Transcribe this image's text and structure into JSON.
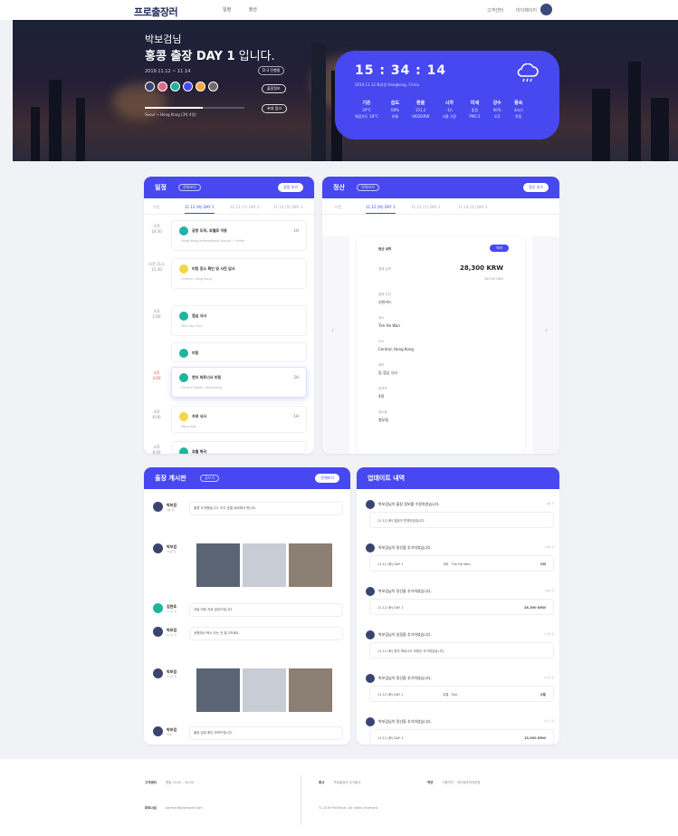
{
  "header": {
    "logo": "프로출장러",
    "nav": [
      "일정",
      "정산"
    ],
    "user_links": [
      "고객센터",
      "마이페이지"
    ]
  },
  "hero": {
    "greeting": "박보검님",
    "title_bold": "홍콩 출장 DAY 1",
    "title_light": " 입니다.",
    "date_range": "2019.11.12 ~ 11.14",
    "tag": "D-3 진행중",
    "edit_button": "출장정보",
    "share_button": "초대 링크",
    "progress": 0.58,
    "route": "Seoul → Hong Kong (3박 4일)",
    "member_colors": [
      "#3b4470",
      "#e06a8a",
      "#1fb4a0",
      "#4748f0",
      "#f3a93a",
      "#6b6b6b"
    ]
  },
  "clock": {
    "time": "15 : 34 : 14",
    "location": "2019.11.12 화요일   Hongkong, China",
    "weather_icon": "rain-cloud-icon",
    "columns": [
      {
        "label": "기온",
        "value": "19°C",
        "sub": "체감온도 18°C"
      },
      {
        "label": "습도",
        "value": "68%",
        "sub": "보통"
      },
      {
        "label": "환율",
        "value": "151.2",
        "sub": "HKD/KRW"
      },
      {
        "label": "시차",
        "value": "-1h",
        "sub": "서울 기준"
      },
      {
        "label": "미세",
        "value": "좋음",
        "sub": "PM2.5"
      },
      {
        "label": "강수",
        "value": "60%",
        "sub": "오후"
      },
      {
        "label": "풍속",
        "value": "3m/s",
        "sub": "북동"
      }
    ]
  },
  "schedule": {
    "title": "일정",
    "badge": "전체보기",
    "pill": "일정 추가",
    "tabs": [
      "이전",
      "11.12 (화) DAY 1",
      "11.13 (수) DAY 2",
      "11.14 (목) DAY 3"
    ],
    "items": [
      {
        "time_a": "오전",
        "time_b": "10:30",
        "name": "공항 도착, 호텔로 이동",
        "right": "1H",
        "sub": "Hong Kong International Airport → Hotel",
        "color": "#1fb4a0"
      },
      {
        "time_a": "오전 11시",
        "time_b": "11:30",
        "name": "미팅 장소 확인 및 사전 답사",
        "right": "",
        "sub": "Central, Hong Kong",
        "color": "#f5d547"
      },
      {
        "time_a": "오후",
        "time_b": "1:00",
        "name": "점심 식사",
        "right": "",
        "sub": "Tsim Sha Tsui",
        "color": "#1fb4a0"
      },
      {
        "time_a": "",
        "time_b": "",
        "name": "미팅",
        "right": "",
        "sub": "",
        "color": "#1fb4a0"
      },
      {
        "time_a": "오후",
        "time_b": "3:00",
        "name": "현지 파트너사 미팅",
        "right": "2H",
        "sub": "Central Tower, Hong Kong",
        "color": "#1fb4a0"
      },
      {
        "time_a": "오후",
        "time_b": "6:00",
        "name": "저녁 식사",
        "right": "1H",
        "sub": "Mong Kok",
        "color": "#f5d547"
      },
      {
        "time_a": "오후",
        "time_b": "8:00",
        "name": "호텔 복귀",
        "right": "",
        "sub": "",
        "color": "#1fb4a0"
      }
    ]
  },
  "expense": {
    "title": "정산",
    "badge": "전체보기",
    "pill": "정산 추가",
    "tabs": [
      "이전",
      "11.12 (화) DAY 1",
      "11.13 (수) DAY 2",
      "11.14 (목) DAY 3"
    ],
    "card_title": "정산 내역",
    "category": "식비",
    "amount_label": "결제 금액",
    "amount": "28,300 KRW",
    "converted": "185.00 HKD",
    "fields": [
      {
        "label": "결제 수단",
        "value": "신한카드"
      },
      {
        "label": "장소",
        "value": "Tim Ho Wan"
      },
      {
        "label": "주소",
        "value": "Central, Hong Kong"
      },
      {
        "label": "메모",
        "value": "팀 점심 식사"
      },
      {
        "label": "참석자",
        "value": "4명"
      },
      {
        "label": "영수증",
        "value": "첨부됨"
      }
    ]
  },
  "board": {
    "title": "출장 게시판",
    "badge": "글쓰기",
    "pill": "전체보기",
    "posts": [
      {
        "name": "박보검",
        "time": "3분 전",
        "text": "홍콩 도착했습니다. 모두 호텔 로비에서 만나요."
      },
      {
        "name": "박보검",
        "time": "15분 전",
        "text": ""
      },
      {
        "name": "김현호",
        "time": "1시간 전",
        "text": "내일 미팅 자료 공유드립니다."
      },
      {
        "name": "박보검",
        "time": "2시간 전",
        "text": "공항에서 택시 타는 곳 참고하세요."
      },
      {
        "name": "박보검",
        "time": "3시간 전",
        "text": ""
      },
      {
        "name": "박보검",
        "time": "어제",
        "text": "출장 일정 확인 부탁드립니다."
      }
    ]
  },
  "updates": {
    "title": "업데이트 내역",
    "items": [
      {
        "head": "박보검님이 출장 정보를 수정하였습니다.",
        "time": "3분 전",
        "box": "11.12 (화) 일정이 변경되었습니다.",
        "right": ""
      },
      {
        "head": "박보검님이 정산을 추가하였습니다.",
        "time": "10분 전",
        "box": "11.12 (화) DAY 1",
        "mid": "식비 · Tim Ho Wan",
        "right": "식비"
      },
      {
        "head": "박보검님이 정산을 추가하였습니다.",
        "time": "30분 전",
        "box": "11.12 (화) DAY 1",
        "mid": "",
        "right": "28,300 KRW"
      },
      {
        "head": "박보검님이 일정을 추가하였습니다.",
        "time": "1시간 전",
        "box": "11.12 (화) 현지 파트너사 미팅이 추가되었습니다.",
        "right": ""
      },
      {
        "head": "박보검님이 정산을 추가하였습니다.",
        "time": "2시간 전",
        "box": "11.12 (화) DAY 1",
        "mid": "교통 · Taxi",
        "right": "교통"
      },
      {
        "head": "박보검님이 정산을 추가하였습니다.",
        "time": "3시간 전",
        "box": "11.12 (화) DAY 1",
        "mid": "",
        "right": "15,000 KRW"
      }
    ]
  },
  "footer": {
    "col1": [
      {
        "label": "고객센터",
        "value": "평일 10:00 - 18:00"
      },
      {
        "label": "파트너십",
        "value": "partner@protravel.com"
      }
    ],
    "col2": [
      {
        "label": "회사",
        "value": "프로출장러 주식회사"
      },
      {
        "label": "약관",
        "value": "이용약관 · 개인정보처리방침"
      }
    ],
    "copyright": "© 2019 ProTravel. All rights reserved."
  }
}
